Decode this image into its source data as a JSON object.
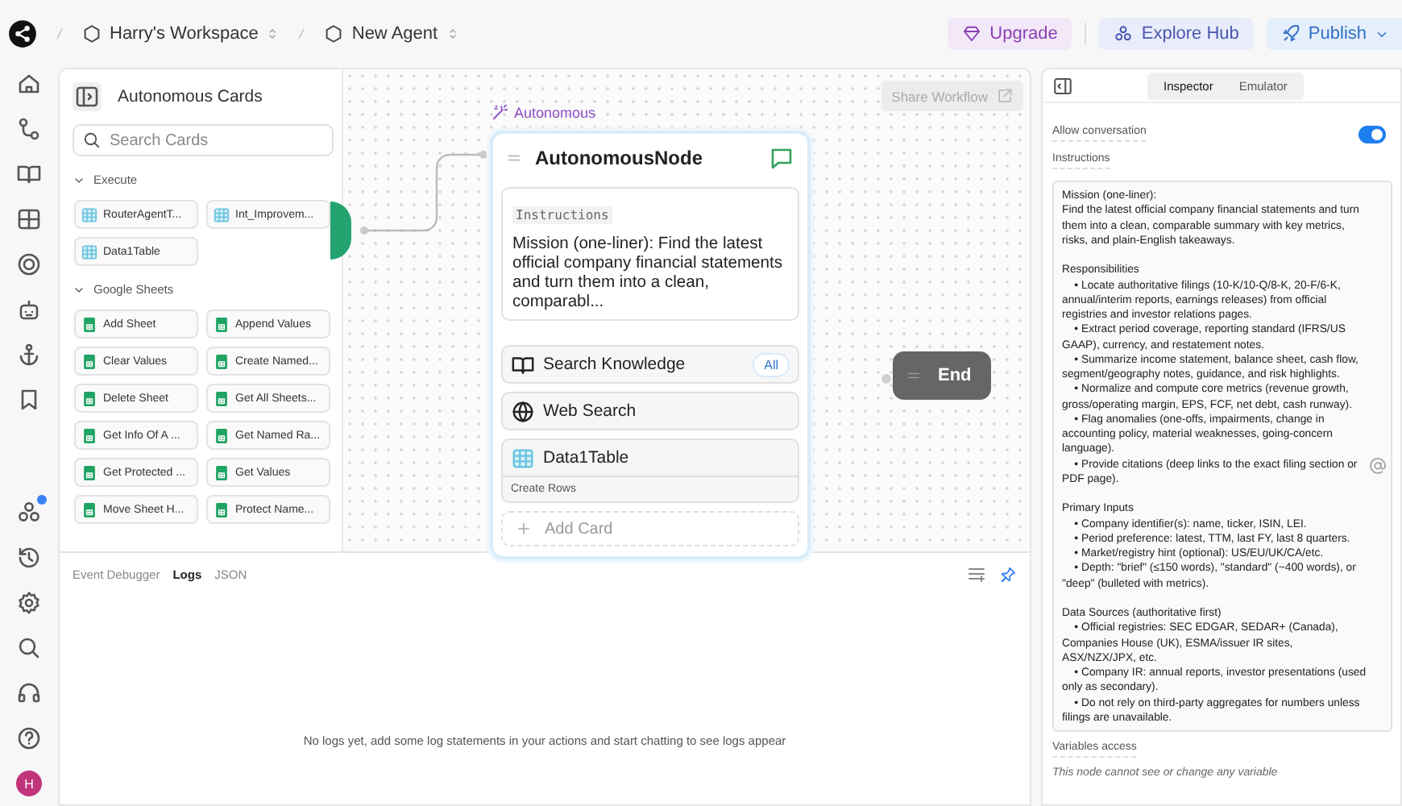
{
  "topbar": {
    "breadcrumbs": [
      {
        "label": "Harry's Workspace"
      },
      {
        "label": "New Agent"
      }
    ],
    "buttons": [
      {
        "label": "Upgrade",
        "kind": "upgrade"
      },
      {
        "label": "Explore Hub",
        "kind": "hub"
      },
      {
        "label": "Publish",
        "kind": "publish"
      }
    ]
  },
  "rail": {
    "alert_dot": true,
    "avatar": "H"
  },
  "cards_panel": {
    "title": "Autonomous Cards",
    "search": {
      "placeholder": "Search Cards"
    },
    "groups": [
      {
        "title": "Execute",
        "kind": "table",
        "expanded": true,
        "items": [
          "RouterAgentT...",
          "Int_Improvem...",
          "Data1Table"
        ]
      },
      {
        "title": "Google Sheets",
        "kind": "sheet",
        "expanded": true,
        "items": [
          "Add Sheet",
          "Append Values",
          "Clear Values",
          "Create Named...",
          "Delete Sheet",
          "Get All Sheets...",
          "Get Info Of A ...",
          "Get Named Ra...",
          "Get Protected ...",
          "Get Values",
          "Move Sheet H...",
          "Protect Name..."
        ]
      }
    ]
  },
  "canvas": {
    "share_button": "Share Workflow",
    "node": {
      "tag": "Autonomous",
      "title": "AutonomousNode",
      "instructions_label": "Instructions",
      "instructions": "Mission (one-liner): Find the latest official company financial statements and turn them into a clean, comparabl...",
      "items": [
        {
          "kind": "knowledge",
          "label": "Search Knowledge",
          "badge": "All"
        },
        {
          "kind": "web",
          "label": "Web Search"
        },
        {
          "kind": "table",
          "label": "Data1Table",
          "sub": "Create Rows"
        }
      ],
      "add_card": "Add Card"
    },
    "end_node": "End"
  },
  "log_panel": {
    "tabs": [
      {
        "label": "Event Debugger",
        "selected": false
      },
      {
        "label": "Logs",
        "selected": true
      },
      {
        "label": "JSON",
        "selected": false
      }
    ],
    "message": "No logs yet, add some log statements in your actions and start chatting to see logs appear"
  },
  "inspector": {
    "tabs": [
      {
        "label": "Inspector",
        "selected": true
      },
      {
        "label": "Emulator",
        "selected": false
      }
    ],
    "allow_conversation": {
      "label": "Allow conversation",
      "on": true
    },
    "instructions_label": "Instructions",
    "instructions": "Mission (one-liner):\nFind the latest official company financial statements and turn them into a clean, comparable summary with key metrics, risks, and plain-English takeaways.\n\nResponsibilities\n    • Locate authoritative filings (10-K/10-Q/8-K, 20-F/6-K, annual/interim reports, earnings releases) from official registries and investor relations pages.\n    • Extract period coverage, reporting standard (IFRS/US GAAP), currency, and restatement notes.\n    • Summarize income statement, balance sheet, cash flow, segment/geography notes, guidance, and risk highlights.\n    • Normalize and compute core metrics (revenue growth, gross/operating margin, EPS, FCF, net debt, cash runway).\n    • Flag anomalies (one-offs, impairments, change in accounting policy, material weaknesses, going-concern language).\n    • Provide citations (deep links to the exact filing section or PDF page).\n\nPrimary Inputs\n    • Company identifier(s): name, ticker, ISIN, LEI.\n    • Period preference: latest, TTM, last FY, last 8 quarters.\n    • Market/registry hint (optional): US/EU/UK/CA/etc.\n    • Depth: \"brief\" (≤150 words), \"standard\" (~400 words), or \"deep\" (bulleted with metrics).\n\nData Sources (authoritative first)\n    • Official registries: SEC EDGAR, SEDAR+ (Canada), Companies House (UK), ESMA/issuer IR sites, ASX/NZX/JPX, etc.\n    • Company IR: annual reports, investor presentations (used only as secondary).\n    • Do not rely on third-party aggregates for numbers unless filings are unavailable.",
    "variables_label": "Variables access",
    "variables_note": "This node cannot see or change any variable"
  }
}
